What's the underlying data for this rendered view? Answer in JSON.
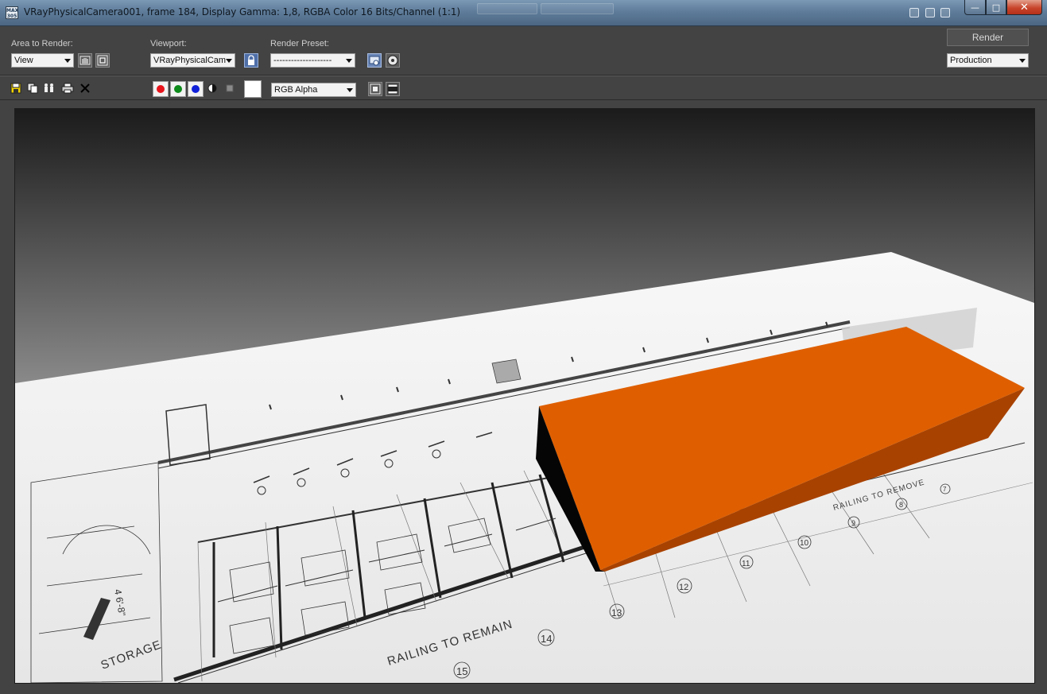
{
  "window": {
    "app_icon_label": "MAX 305",
    "title": "VRayPhysicalCamera001, frame 184, Display Gamma: 1,8, RGBA Color 16 Bits/Channel (1:1)",
    "minimize_symbol": "—",
    "maximize_symbol": "□",
    "close_symbol": "✕"
  },
  "toolbar": {
    "area_to_render": {
      "label": "Area to Render:",
      "value": "View"
    },
    "viewport": {
      "label": "Viewport:",
      "value": "VRayPhysicalCam"
    },
    "render_preset": {
      "label": "Render Preset:",
      "value": "--------------------"
    },
    "render_button": "Render",
    "render_mode": "Production",
    "channel_display": "RGB Alpha"
  },
  "icons": {
    "region": "region-icon",
    "crop": "crop-icon",
    "lock": "lock-icon",
    "setup": "render-setup-icon",
    "env": "environment-icon",
    "save": "save-image-icon",
    "copy": "copy-image-icon",
    "clone": "clone-window-icon",
    "print": "print-icon",
    "clear": "clear-icon",
    "mono": "monochrome-icon",
    "alpha": "alpha-icon"
  },
  "colors": {
    "red_channel": "#e8141c",
    "green_channel": "#0c8a1a",
    "blue_channel": "#1020d8",
    "box_top": "#df5f00",
    "box_front": "#a84200",
    "box_end": "#050505",
    "swatch": "#ffffff"
  },
  "drawing": {
    "caption_railing": "RAILING TO REMAIN",
    "caption_storage": "STORAGE",
    "caption_railing_right": "RAILING TO REMOVE",
    "caption_elev": "4 6'-8\"",
    "grid_labels": [
      "15",
      "14",
      "13",
      "12",
      "11",
      "10",
      "9",
      "8",
      "7"
    ]
  }
}
